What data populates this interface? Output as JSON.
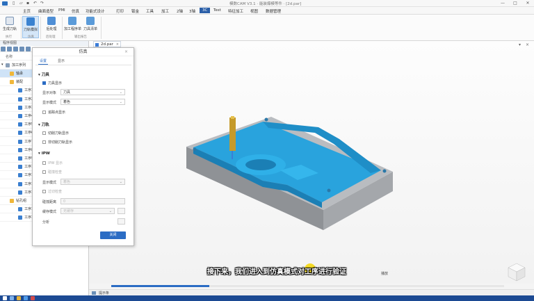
{
  "window": {
    "title": "模数CAM V3.1 · 能装爆模等件 · [2d.par]",
    "minimize": "—",
    "maximize": "□",
    "close": "✕"
  },
  "menu": {
    "items": [
      "主页",
      "曲面造型",
      "PMI",
      "仿真",
      "功能式设计",
      "打印",
      "钣金",
      "工具",
      "加工",
      "2轴",
      "3轴",
      "3C",
      "Test",
      "特征加工",
      "视图",
      "数据管理"
    ],
    "active_index": 11
  },
  "ribbon": {
    "buttons": [
      "生成刀轨",
      "刀轨模拟",
      "后处理",
      "加工程序单",
      "刀具清单"
    ],
    "groups": [
      "执行",
      "仿真",
      "后处理",
      "输出报告"
    ]
  },
  "tree": {
    "panel_title": "程序视图",
    "column": "名称",
    "root": "加工序列",
    "rows": [
      "轴承",
      "装配",
      "工序1",
      "工序2",
      "工序3",
      "工序4",
      "工序5",
      "工序6",
      "工序7",
      "工序8",
      "工序9",
      "工序10",
      "工序11",
      "工序12",
      "工序13",
      "钻孔组",
      "工序14",
      "工序15"
    ]
  },
  "document_tab": {
    "label": "2d.par",
    "close": "×"
  },
  "dialog": {
    "title": "仿真",
    "close": "×",
    "tabs": [
      "设置",
      "显示"
    ],
    "sections": {
      "tool": {
        "title": "刀具",
        "show_tool": "刀具显示",
        "display_object_label": "显示对象",
        "display_object_value": "刀具",
        "display_mode_label": "显示模式",
        "display_mode_value": "着色",
        "follow_show": "追踪点显示"
      },
      "toolpath": {
        "title": "刀轨",
        "cut_show": "切削刀轨显示",
        "noncut_show": "非切削刀轨显示"
      },
      "ipw": {
        "title": "IPW",
        "ipw_display": "IPW 显示",
        "collision": "碰撞检查",
        "mode_label": "显示模式",
        "mode_value": "着色",
        "compare": "过切检查",
        "tolerance_label": "碰撞距离",
        "tolerance_value": "0",
        "cache_label": "缓存模式",
        "cache_value": "无缓存",
        "analysis_label": "分析"
      }
    },
    "ok": "关闭"
  },
  "progress": {
    "fraction": 0.25
  },
  "status": {
    "text": "提示条"
  },
  "overlay": {
    "subtitle": "接下来，我们进入到仿真模式对工序进行验证",
    "hint": "播放"
  },
  "colors": {
    "accent": "#2b6cc4",
    "part_blue": "#29a3dd",
    "part_gray": "#8f9296",
    "taskbar": "#1c4a93"
  }
}
